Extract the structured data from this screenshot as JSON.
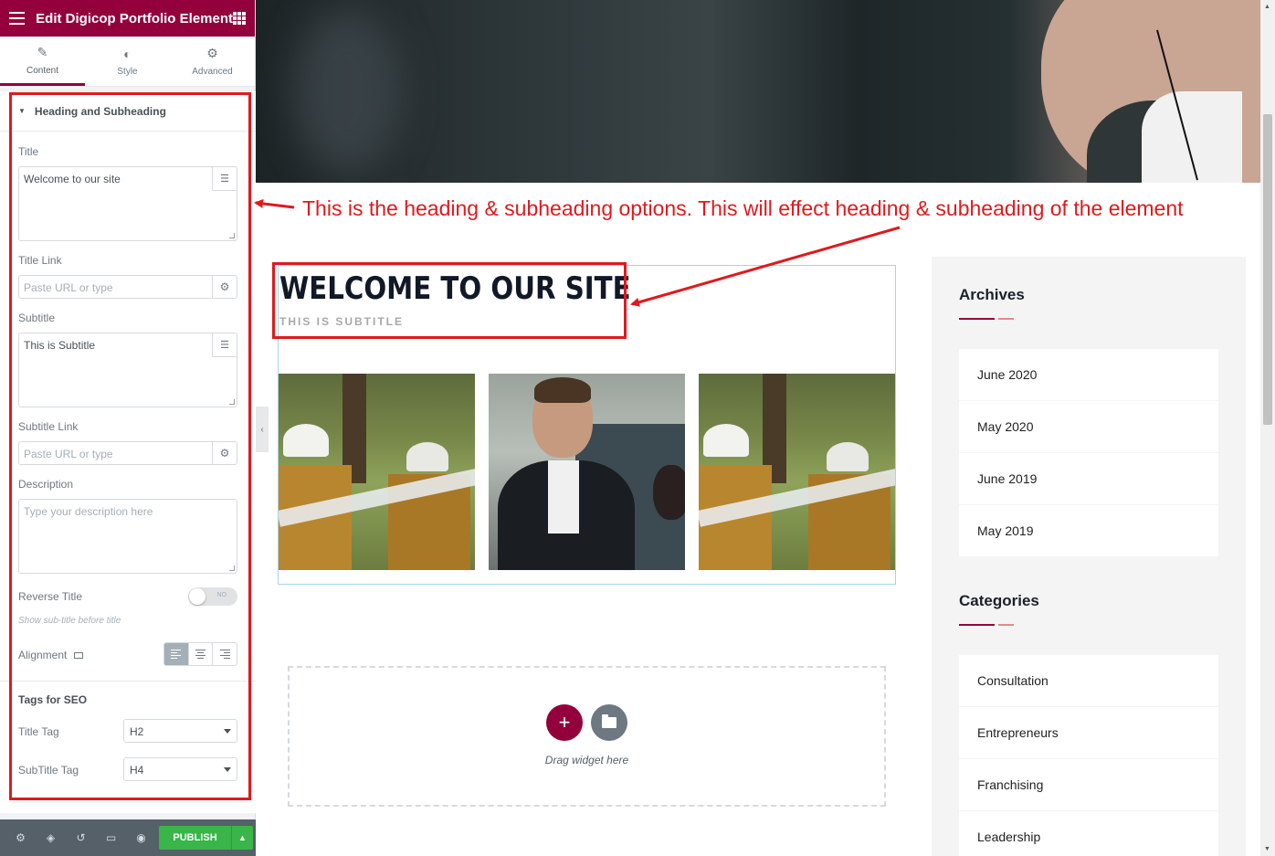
{
  "panel": {
    "title": "Edit Digicop Portfolio Element",
    "tabs": [
      {
        "label": "Content",
        "icon": "pencil-icon"
      },
      {
        "label": "Style",
        "icon": "contrast-icon"
      },
      {
        "label": "Advanced",
        "icon": "gear-icon"
      }
    ],
    "section_title": "Heading and Subheading",
    "fields": {
      "title_label": "Title",
      "title_value": "Welcome to our site",
      "title_link_label": "Title Link",
      "title_link_placeholder": "Paste URL or type",
      "subtitle_label": "Subtitle",
      "subtitle_value": "This is Subtitle",
      "subtitle_link_label": "Subtitle Link",
      "subtitle_link_placeholder": "Paste URL or type",
      "description_label": "Description",
      "description_placeholder": "Type your description here",
      "reverse_title_label": "Reverse Title",
      "reverse_title_state": "NO",
      "reverse_title_hint": "Show sub-title before title",
      "alignment_label": "Alignment"
    },
    "seo": {
      "heading": "Tags for SEO",
      "title_tag_label": "Title Tag",
      "title_tag_value": "H2",
      "subtitle_tag_label": "SubTitle Tag",
      "subtitle_tag_value": "H4"
    },
    "footer": {
      "publish_label": "PUBLISH"
    }
  },
  "annotation": {
    "text": "This is the heading & subheading options. This will effect heading & subheading of the element"
  },
  "preview": {
    "heading": "WELCOME TO OUR SITE",
    "subheading": "THIS IS SUBTITLE",
    "drag_text": "Drag widget here"
  },
  "sidebar": {
    "archives_title": "Archives",
    "archives": [
      "June 2020",
      "May 2020",
      "June 2019",
      "May 2019"
    ],
    "categories_title": "Categories",
    "categories": [
      "Consultation",
      "Entrepreneurs",
      "Franchising",
      "Leadership"
    ]
  },
  "colors": {
    "brand": "#93003c",
    "annotation_red": "#e0191e",
    "publish_green": "#39b54a"
  }
}
